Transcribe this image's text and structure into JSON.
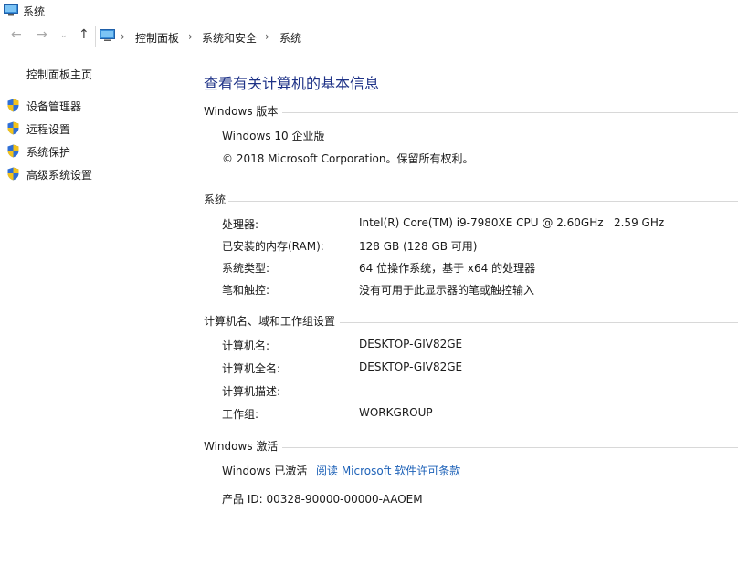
{
  "window": {
    "title": "系统"
  },
  "nav": {
    "back_icon": "arrow-left-icon",
    "forward_icon": "arrow-right-icon",
    "recent_icon": "chevron-down-icon",
    "up_icon": "arrow-up-icon",
    "breadcrumb": [
      "控制面板",
      "系统和安全",
      "系统"
    ]
  },
  "sidebar": {
    "home": "控制面板主页",
    "items": [
      {
        "label": "设备管理器",
        "icon": "shield-icon"
      },
      {
        "label": "远程设置",
        "icon": "shield-icon"
      },
      {
        "label": "系统保护",
        "icon": "shield-icon"
      },
      {
        "label": "高级系统设置",
        "icon": "shield-icon"
      }
    ]
  },
  "main": {
    "title": "查看有关计算机的基本信息",
    "edition": {
      "heading": "Windows 版本",
      "name": "Windows 10 企业版",
      "copyright": "© 2018 Microsoft Corporation。保留所有权利。"
    },
    "system": {
      "heading": "系统",
      "rows": [
        {
          "label": "处理器:",
          "value": "Intel(R) Core(TM) i9-7980XE CPU @ 2.60GHz   2.59 GHz"
        },
        {
          "label": "已安装的内存(RAM):",
          "value": "128 GB (128 GB 可用)"
        },
        {
          "label": "系统类型:",
          "value": "64 位操作系统，基于 x64 的处理器"
        },
        {
          "label": "笔和触控:",
          "value": "没有可用于此显示器的笔或触控输入"
        }
      ]
    },
    "computer": {
      "heading": "计算机名、域和工作组设置",
      "rows": [
        {
          "label": "计算机名:",
          "value": "DESKTOP-GIV82GE"
        },
        {
          "label": "计算机全名:",
          "value": "DESKTOP-GIV82GE"
        },
        {
          "label": "计算机描述:",
          "value": ""
        },
        {
          "label": "工作组:",
          "value": "WORKGROUP"
        }
      ]
    },
    "activation": {
      "heading": "Windows 激活",
      "status": "Windows 已激活",
      "license_link": "阅读 Microsoft 软件许可条款",
      "product_id": "产品 ID: 00328-90000-00000-AAOEM"
    }
  },
  "colors": {
    "title_blue": "#1e3287",
    "link_blue": "#1e62b8",
    "divider": "#d8d8d8",
    "shield_blue": "#2f6fd6",
    "shield_yellow": "#f2c21b"
  }
}
